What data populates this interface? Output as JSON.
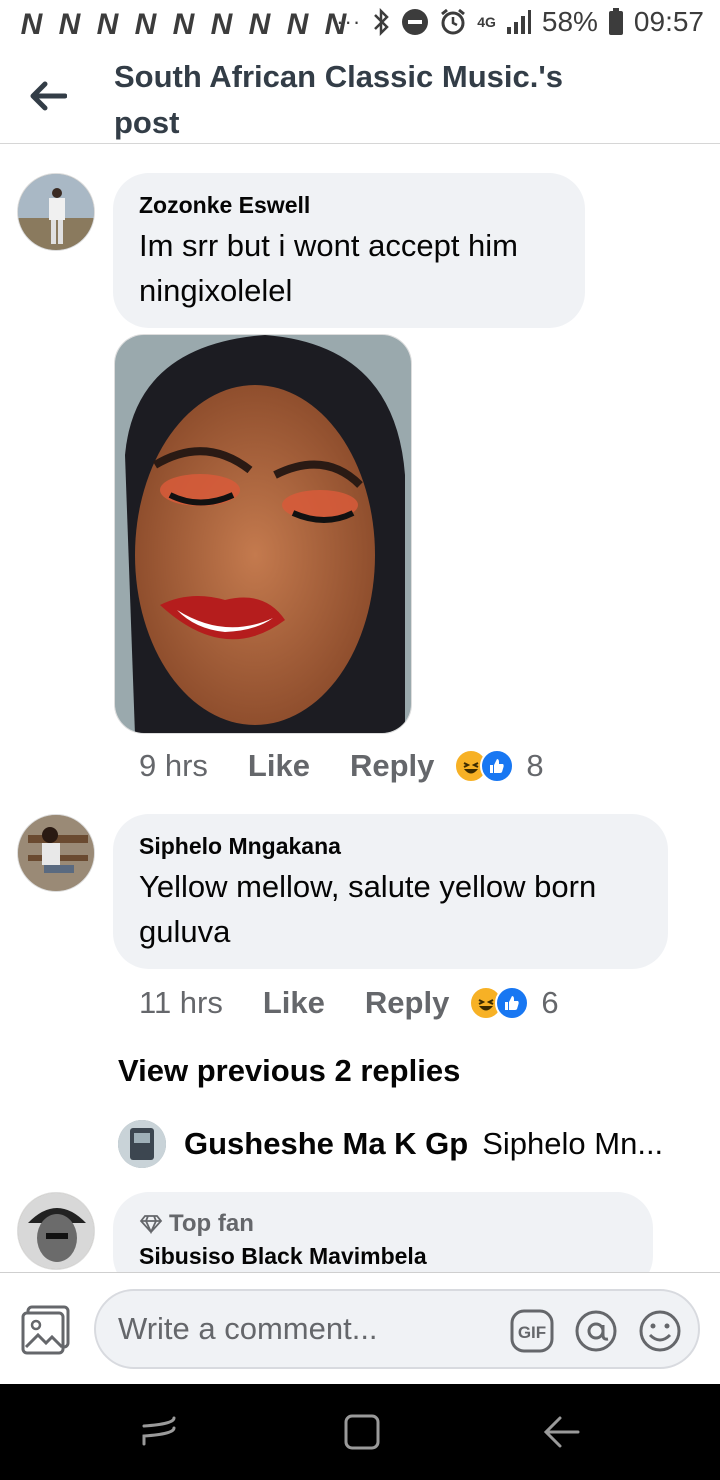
{
  "status_bar": {
    "notification_letters": [
      "N",
      "N",
      "N",
      "N",
      "N",
      "N",
      "N",
      "N",
      "N"
    ],
    "more": "···",
    "network": "4G",
    "battery_percent": "58%",
    "time": "09:57"
  },
  "header": {
    "title": "South African Classic Music.'s post"
  },
  "comments": [
    {
      "author": "Zozonke Eswell",
      "text": "Im srr but i wont accept him ningixolelel",
      "time": "9 hrs",
      "like_label": "Like",
      "reply_label": "Reply",
      "reaction_count": "8",
      "reactions": [
        "haha",
        "like"
      ]
    },
    {
      "author": "Siphelo Mngakana",
      "text": "Yellow mellow, salute yellow born guluva",
      "time": "11 hrs",
      "like_label": "Like",
      "reply_label": "Reply",
      "reaction_count": "6",
      "reactions": [
        "haha",
        "like"
      ]
    }
  ],
  "replies": {
    "view_previous_label": "View previous 2 replies",
    "preview_author": "Gusheshe Ma K Gp",
    "preview_snippet": "Siphelo Mn..."
  },
  "partial_comment": {
    "badge": "Top fan",
    "author": "Sibusiso Black Mavimbela"
  },
  "composer": {
    "placeholder": "Write a comment...",
    "gif_label": "GIF"
  },
  "colors": {
    "bubble": "#f0f2f5",
    "like_blue": "#1877f2",
    "haha_yellow": "#f7b125",
    "secondary_text": "#65676b"
  }
}
